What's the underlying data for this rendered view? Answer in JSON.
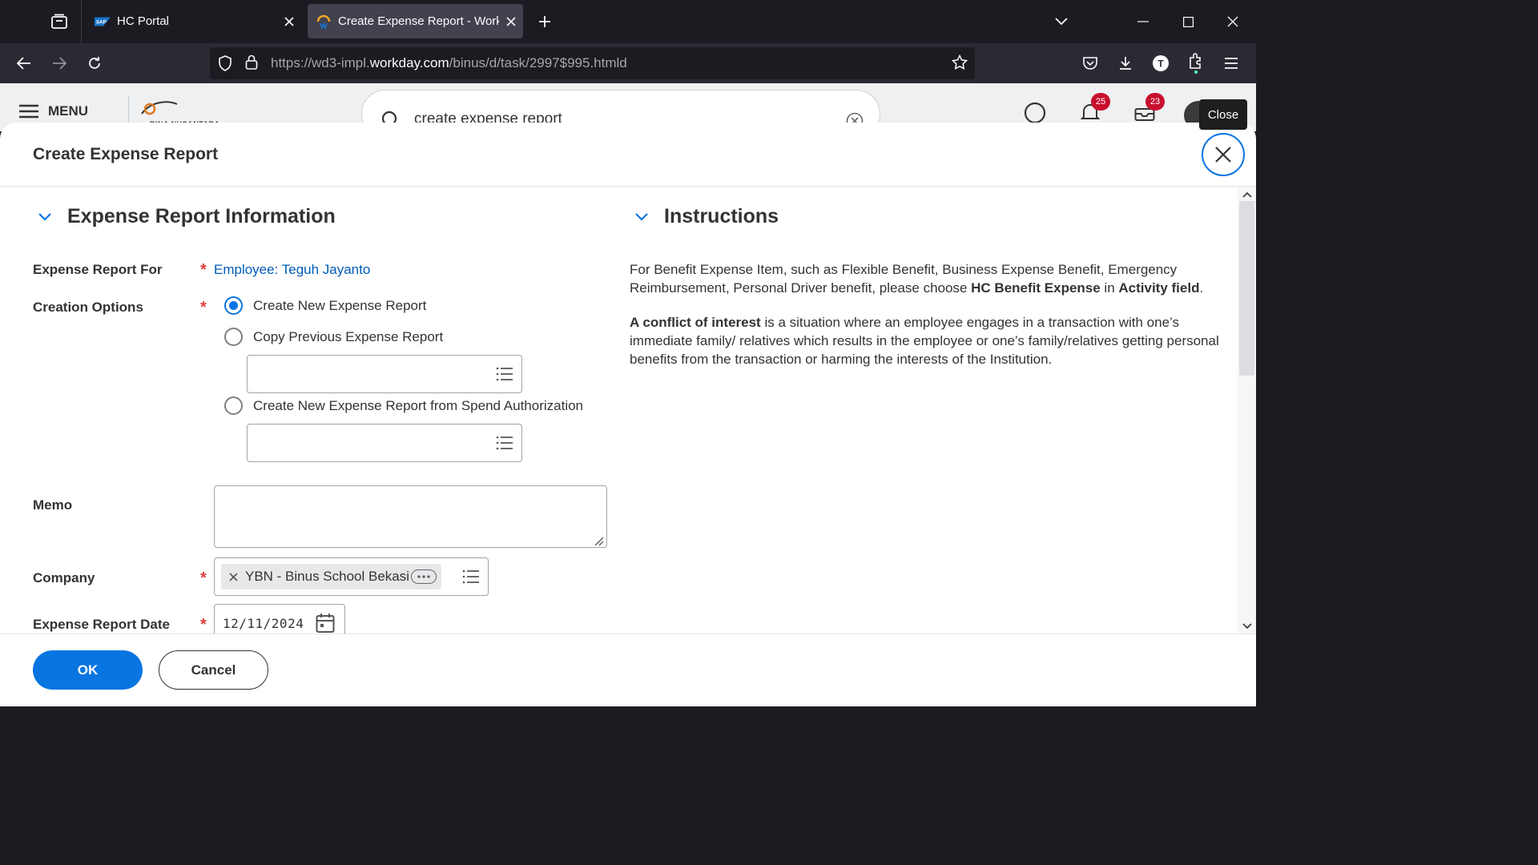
{
  "browser": {
    "tabs": [
      {
        "title": "HC Portal",
        "favicon": "sap-icon"
      },
      {
        "title": "Create Expense Report - Workd",
        "favicon": "workday-icon"
      }
    ],
    "url_prefix": "https://wd3-impl.",
    "url_host": "workday.com",
    "url_path": "/binus/d/task/2997$995.htmld"
  },
  "workday_header": {
    "menu_label": "MENU",
    "logo_text": "BINA NUSANTARA",
    "search_value": "create expense report",
    "notifications_count": "25",
    "inbox_count": "23"
  },
  "tooltip": {
    "text": "Close"
  },
  "modal": {
    "title": "Create Expense Report",
    "sections": {
      "info_title": "Expense Report Information",
      "instructions_title": "Instructions"
    },
    "fields": {
      "report_for_label": "Expense Report For",
      "report_for_value": "Employee: Teguh Jayanto",
      "creation_options_label": "Creation Options",
      "options": [
        {
          "label": "Create New Expense Report",
          "checked": true
        },
        {
          "label": "Copy Previous Expense Report",
          "checked": false
        },
        {
          "label": "Create New Expense Report from Spend Authorization",
          "checked": false
        }
      ],
      "memo_label": "Memo",
      "memo_value": "",
      "company_label": "Company",
      "company_value": "YBN - Binus School Bekasi",
      "date_label": "Expense Report Date",
      "date_value": "12/11/2024",
      "required_mark": "*"
    },
    "instructions": {
      "p1_a": "For Benefit Expense Item, such as Flexible Benefit, Business Expense Benefit, Emergency Reimbursement, Personal Driver benefit, please choose ",
      "p1_b": "HC Benefit Expense",
      "p1_c": " in ",
      "p1_d": "Activity field",
      "p1_e": ".",
      "p2_a": "A conflict of interest",
      "p2_b": " is a situation where an employee engages in a transaction with one’s immediate family/ relatives which results in the employee or one’s family/relatives getting personal benefits from the transaction or harming the interests of the Institution."
    },
    "buttons": {
      "ok": "OK",
      "cancel": "Cancel"
    }
  },
  "colors": {
    "accent": "#0875e1",
    "required": "#de4040",
    "link": "#005cb9"
  }
}
